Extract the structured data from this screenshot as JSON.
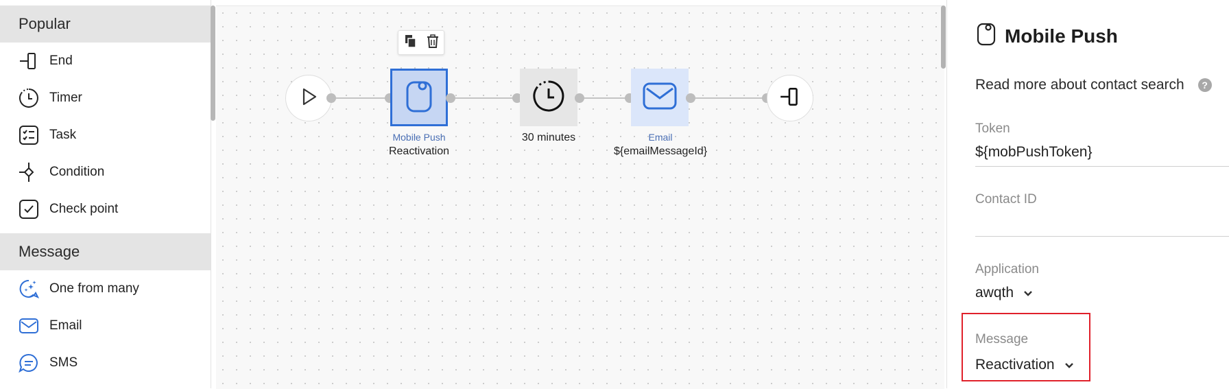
{
  "sidebar": {
    "sections": [
      {
        "title": "Popular",
        "items": [
          {
            "label": "End",
            "icon": "end-icon"
          },
          {
            "label": "Timer",
            "icon": "timer-icon"
          },
          {
            "label": "Task",
            "icon": "task-icon"
          },
          {
            "label": "Condition",
            "icon": "condition-icon"
          },
          {
            "label": "Check point",
            "icon": "check-point-icon"
          }
        ]
      },
      {
        "title": "Message",
        "items": [
          {
            "label": "One from many",
            "icon": "one-from-many-icon"
          },
          {
            "label": "Email",
            "icon": "email-icon"
          },
          {
            "label": "SMS",
            "icon": "sms-icon"
          }
        ]
      }
    ]
  },
  "canvas": {
    "nodes": {
      "mobile_push": {
        "type": "Mobile Push",
        "label": "Reactivation"
      },
      "timer": {
        "label": "30 minutes"
      },
      "email": {
        "type": "Email",
        "label": "${emailMessageId}"
      }
    }
  },
  "panel": {
    "title": "Mobile Push",
    "help_text": "Read more about contact search",
    "fields": {
      "token": {
        "label": "Token",
        "value": "${mobPushToken}"
      },
      "contact_id": {
        "label": "Contact ID",
        "value": ""
      },
      "application": {
        "label": "Application",
        "value": "awqth"
      },
      "message": {
        "label": "Message",
        "value": "Reactivation"
      }
    }
  },
  "colors": {
    "accent_blue": "#2f6fd6",
    "selected_node_bg": "#c6d6f3",
    "highlight_red": "#e0202a"
  }
}
